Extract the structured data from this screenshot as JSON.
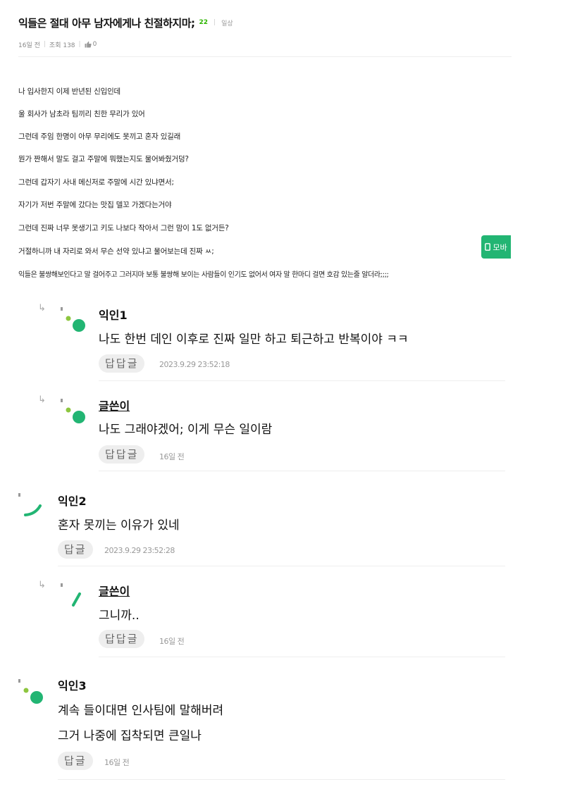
{
  "post": {
    "title": "익들은 절대 아무 남자에게나 친절하지마;",
    "comment_count": "22",
    "category": "일상",
    "time": "16일 전",
    "views": "조회 138",
    "likes": "0",
    "body": [
      "나 입사한지 이제 반년된 신입인데",
      "울 회사가 남초라 팀끼리 친한 무리가 있어",
      "그런데 주임 한명이 아무 무리에도 못끼고 혼자 있길래",
      "뭔가 짠해서 말도 걸고 주말에 뭐했는지도 물어봐줬거덩?",
      "그런데 갑자기 사내 메신저로 주말에 시간 있냐면서;",
      "자기가 저번 주말에 갔다는 맛집 델꼬 가겠다는거야",
      "그런데 진짜 너무 못생기고 키도 나보다 작아서 그런 맘이 1도 없거든?",
      "거절하니까 내 자리로 와서 무슨 선약 있냐고 물어보는데 진짜 ㅆ;",
      "익들은 불쌍해보인다고 말 걸어주고 그러지마 보통 불쌍해 보이는 사람들이 인기도 없어서 여자 말 한마디 걸면 호감 있는줄 알더라;;;;"
    ]
  },
  "mobile_button": {
    "label": "모바"
  },
  "comments": [
    {
      "name": "익인1",
      "text": [
        "나도 한번 데인 이후로 진짜 일만 하고 퇴근하고 반복이야 ㅋㅋ"
      ],
      "reply_label": "답답글",
      "time": "2023.9.29 23:52:18",
      "is_reply": true,
      "is_author": false
    },
    {
      "name": "글쓴이",
      "text": [
        "나도 그래야겠어; 이게 무슨 일이람"
      ],
      "reply_label": "답답글",
      "time": "16일 전",
      "is_reply": true,
      "is_author": true
    },
    {
      "name": "익인2",
      "text": [
        "혼자 못끼는 이유가 있네"
      ],
      "reply_label": "답글",
      "time": "2023.9.29 23:52:28",
      "is_reply": false,
      "is_author": false
    },
    {
      "name": "글쓴이",
      "text": [
        "그니까.."
      ],
      "reply_label": "답답글",
      "time": "16일 전",
      "is_reply": true,
      "is_author": true
    },
    {
      "name": "익인3",
      "text": [
        "계속 들이대면 인사팀에 말해버려",
        "그거 나중에 집착되면 큰일나"
      ],
      "reply_label": "답글",
      "time": "16일 전",
      "is_reply": false,
      "is_author": false
    }
  ],
  "colors": {
    "accent_green": "#2db400",
    "avatar_green": "#22b573",
    "avatar_lime": "#8dc63f"
  }
}
